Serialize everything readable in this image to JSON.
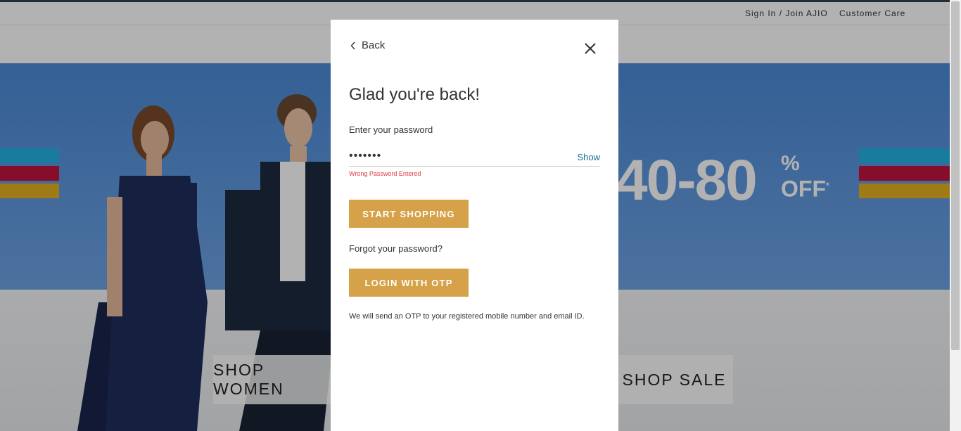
{
  "header": {
    "sign_in_label": "Sign In / Join AJIO",
    "customer_care_label": "Customer Care"
  },
  "hero": {
    "discount": "40-80",
    "percent": "%",
    "off": "OFF",
    "asterisk": "*",
    "shop_women_label": "SHOP WOMEN",
    "shop_sale_label": "SHOP SALE",
    "stripe_colors": [
      "#22b2e3",
      "#c0153e",
      "#e4b020"
    ]
  },
  "modal": {
    "back_label": "Back",
    "title": "Glad you're back!",
    "password_label": "Enter your password",
    "password_value": "•••••••",
    "show_label": "Show",
    "error_text": "Wrong Password Entered",
    "start_shopping_label": "START SHOPPING",
    "forgot_label": "Forgot your password?",
    "login_otp_label": "LOGIN WITH OTP",
    "otp_note": "We will send an OTP to your registered mobile number and email ID."
  },
  "colors": {
    "accent_gold": "#d5a249",
    "link_blue": "#176d93",
    "error_red": "#e0393e"
  }
}
